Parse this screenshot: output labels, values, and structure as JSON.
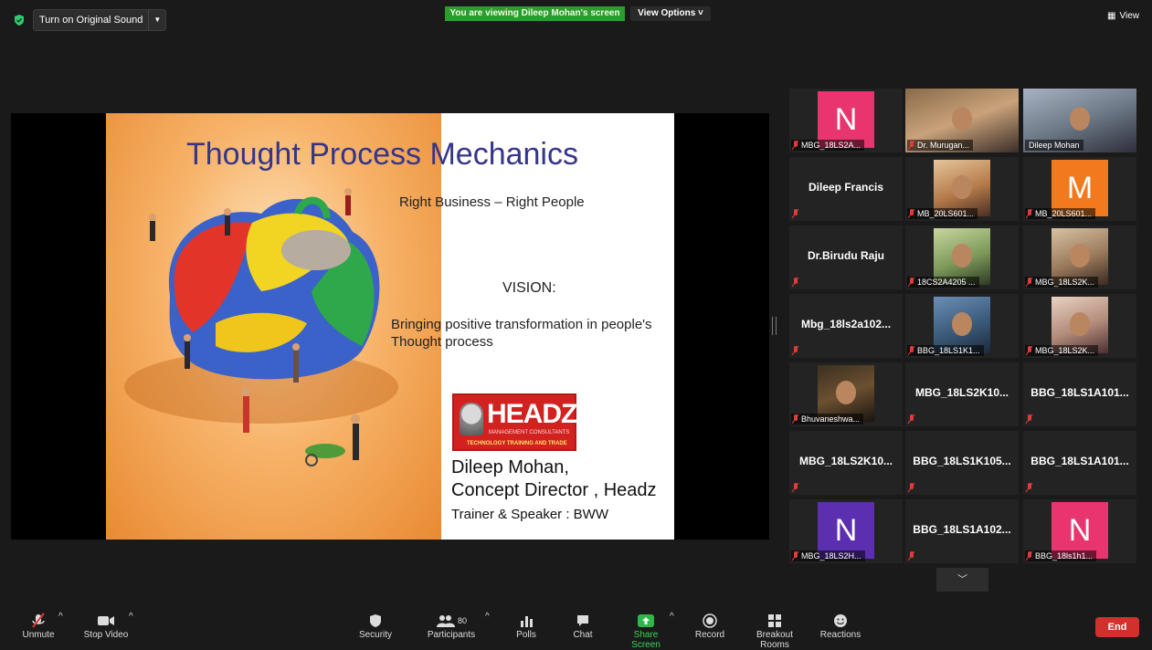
{
  "top_bar": {
    "original_sound_label": "Turn on Original Sound",
    "viewing_banner": "You are viewing Dileep Mohan's screen",
    "view_options_label": "View Options ˅",
    "view_label": "View",
    "accent_green": "#2e9b2e"
  },
  "slide": {
    "title": "Thought Process Mechanics",
    "subtitle": "Right Business – Right People",
    "vision_heading": "VISION:",
    "vision_text": "Bringing positive transformation in people's Thought process",
    "logo_word": "HEADZ",
    "logo_tagline": "MANAGEMENT CONSULTANTS",
    "logo_subtagline": "TECHNOLOGY TRAINING AND TRADE",
    "speaker_line1": "Dileep Mohan,",
    "speaker_line2": "Concept Director , Headz",
    "speaker_role": "Trainer & Speaker : BWW"
  },
  "gallery": [
    {
      "label": "MBG_18LS2A...",
      "type": "avatar",
      "letter": "N",
      "color": "#e8356f"
    },
    {
      "label": "Dr. Murugan...",
      "type": "video"
    },
    {
      "label": "Dileep Mohan",
      "type": "video",
      "active": true
    },
    {
      "label": "Dileep Francis",
      "type": "name"
    },
    {
      "label": "MB_20LS601...",
      "type": "photo"
    },
    {
      "label": "MB_20LS601...",
      "type": "avatar",
      "letter": "M",
      "color": "#f07a1d"
    },
    {
      "label": "Dr.Birudu Raju",
      "type": "name"
    },
    {
      "label": "18CS2A4205 ...",
      "type": "photo"
    },
    {
      "label": "MBG_18LS2K...",
      "type": "photo"
    },
    {
      "label": "Mbg_18ls2a102...",
      "type": "name"
    },
    {
      "label": "BBG_18LS1K1...",
      "type": "photo"
    },
    {
      "label": "MBG_18LS2K...",
      "type": "photo"
    },
    {
      "label": "Bhuvaneshwa...",
      "type": "photo"
    },
    {
      "label": "MBG_18LS2K10...",
      "type": "name"
    },
    {
      "label": "BBG_18LS1A101...",
      "type": "name"
    },
    {
      "label": "MBG_18LS2K10...",
      "type": "name"
    },
    {
      "label": "BBG_18LS1K105...",
      "type": "name"
    },
    {
      "label": "BBG_18LS1A101...",
      "type": "name"
    },
    {
      "label": "MBG_18LS2H...",
      "type": "avatar",
      "letter": "N",
      "color": "#5b2fb0"
    },
    {
      "label": "BBG_18LS1A102...",
      "type": "name"
    },
    {
      "label": "BBG_18ls1h1...",
      "type": "avatar",
      "letter": "N",
      "color": "#e8356f"
    }
  ],
  "toolbar": {
    "unmute": "Unmute",
    "stop_video": "Stop Video",
    "security": "Security",
    "participants": "Participants",
    "participants_count": "80",
    "polls": "Polls",
    "chat": "Chat",
    "share_screen": "Share Screen",
    "record": "Record",
    "breakout_rooms": "Breakout Rooms",
    "reactions": "Reactions",
    "end": "End"
  }
}
